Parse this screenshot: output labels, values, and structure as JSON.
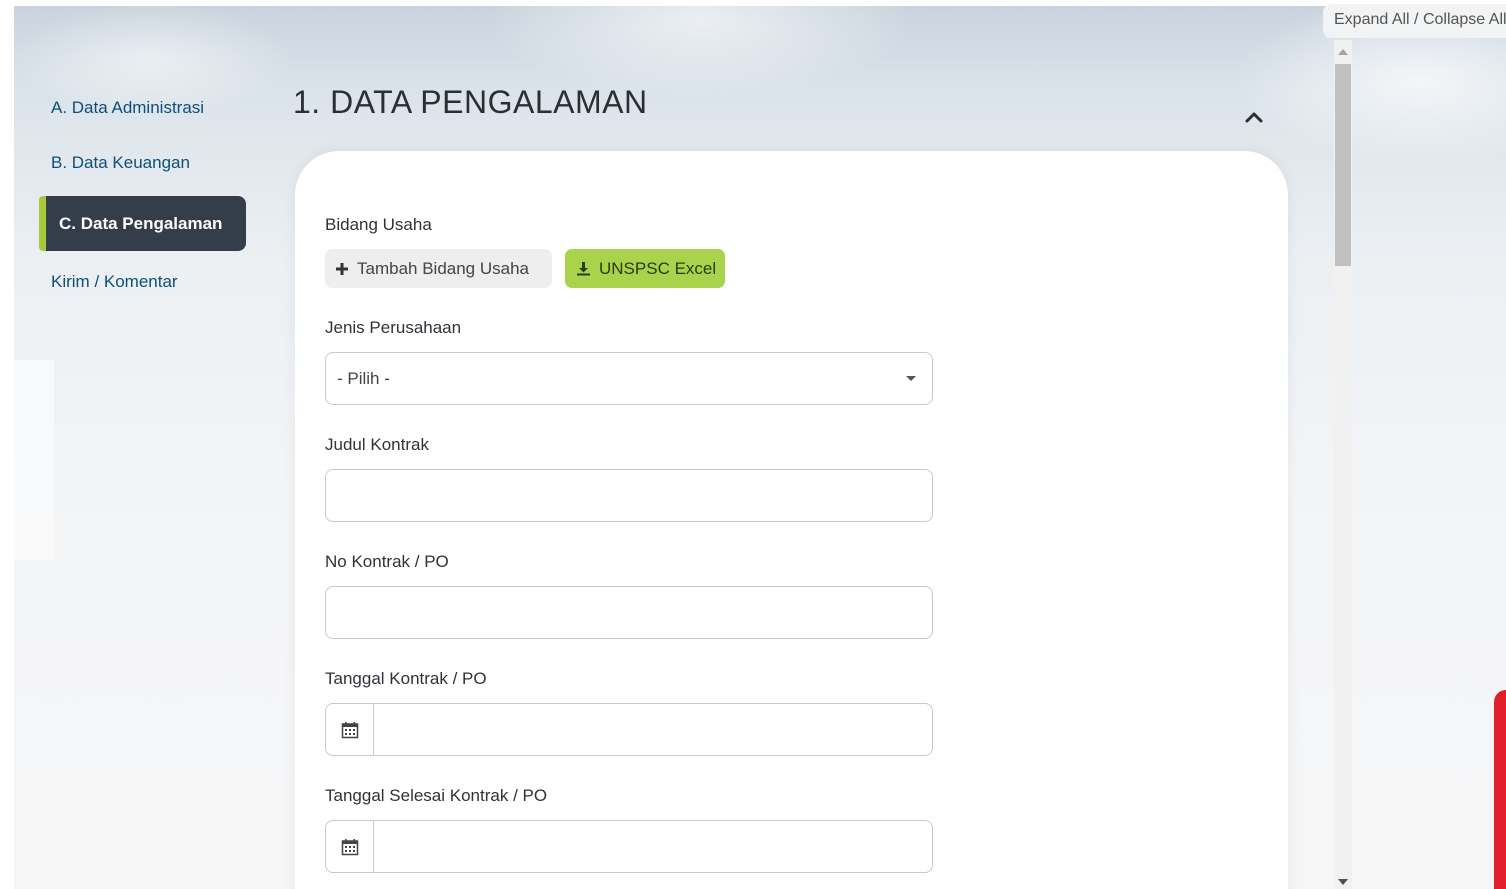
{
  "sidebar": {
    "items": [
      {
        "label": "A. Data Administrasi",
        "active": false
      },
      {
        "label": "B. Data Keuangan",
        "active": false
      },
      {
        "label": "C. Data Pengalaman",
        "active": true
      },
      {
        "label": "Kirim / Komentar",
        "active": false
      }
    ]
  },
  "section": {
    "title": "1. DATA PENGALAMAN",
    "collapse_icon": "chevron-up-icon"
  },
  "form": {
    "bidang_usaha": {
      "label": "Bidang Usaha",
      "add_button": "Tambah Bidang Usaha",
      "add_icon": "plus-icon",
      "excel_button": "UNSPSC Excel",
      "excel_icon": "download-icon"
    },
    "jenis_perusahaan": {
      "label": "Jenis Perusahaan",
      "selected": "- Pilih -"
    },
    "judul_kontrak": {
      "label": "Judul Kontrak",
      "value": ""
    },
    "no_kontrak": {
      "label": "No Kontrak / PO",
      "value": ""
    },
    "tanggal_kontrak": {
      "label": "Tanggal Kontrak / PO",
      "value": "",
      "icon": "calendar-icon"
    },
    "tanggal_selesai": {
      "label": "Tanggal Selesai Kontrak / PO",
      "value": "",
      "icon": "calendar-icon"
    }
  },
  "panel": {
    "expand_collapse": "Expand All / Collapse All"
  },
  "colors": {
    "nav_active_bg": "#343e4a",
    "nav_active_accent": "#a7c83a",
    "nav_link": "#0e4f7a",
    "excel_button_bg": "#a9d34a",
    "brand_red": "#e21e2b"
  }
}
